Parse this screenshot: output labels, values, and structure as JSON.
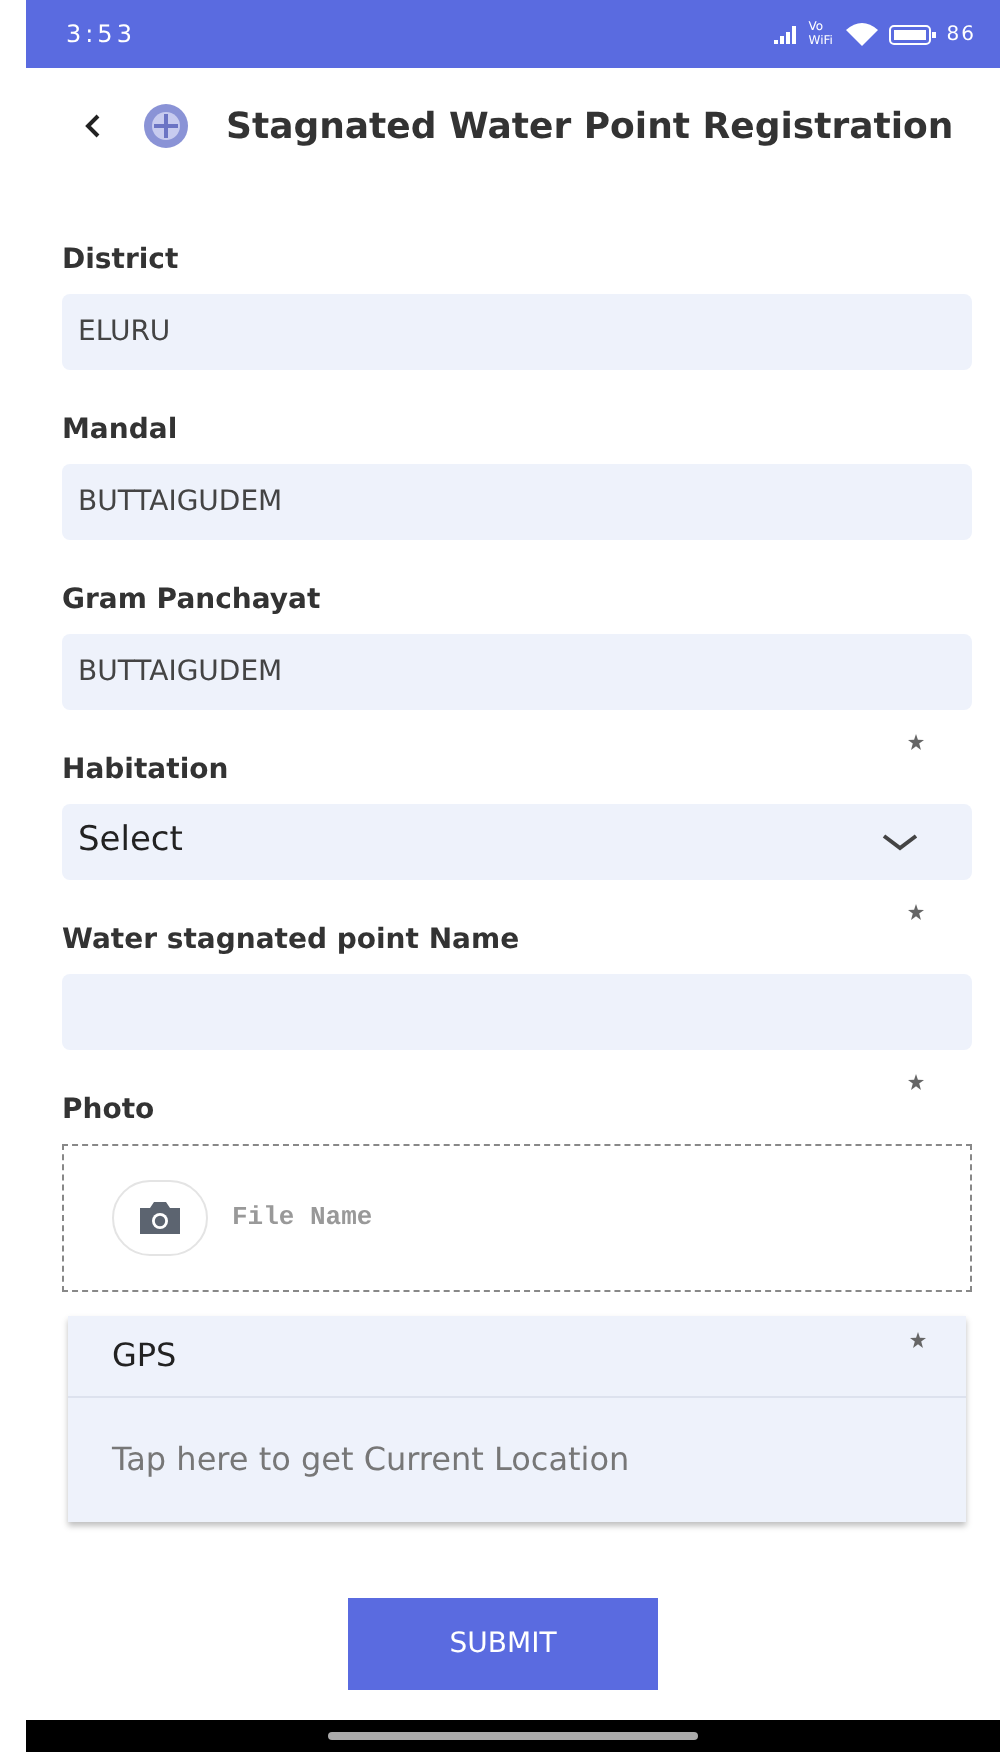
{
  "status_bar": {
    "time": "3:53",
    "network": "Vo WiFi",
    "battery": "86"
  },
  "header": {
    "title": "Stagnated Water Point Registration"
  },
  "fields": [
    {
      "kind": "text",
      "label": "District",
      "value": "ELURU",
      "required": false
    },
    {
      "kind": "text",
      "label": "Mandal",
      "value": "BUTTAIGUDEM",
      "required": false
    },
    {
      "kind": "text",
      "label": "Gram Panchayat",
      "value": "BUTTAIGUDEM",
      "required": false
    },
    {
      "kind": "select",
      "label": "Habitation",
      "value": "Select",
      "required": true
    },
    {
      "kind": "input",
      "label": "Water stagnated point Name",
      "required": true
    },
    {
      "kind": "photo",
      "label": "Photo",
      "file": "File Name",
      "required": true
    },
    {
      "kind": "gps",
      "label": "GPS",
      "hint": "Tap here to get Current Location",
      "required": true
    }
  ],
  "submit": "SUBMIT"
}
